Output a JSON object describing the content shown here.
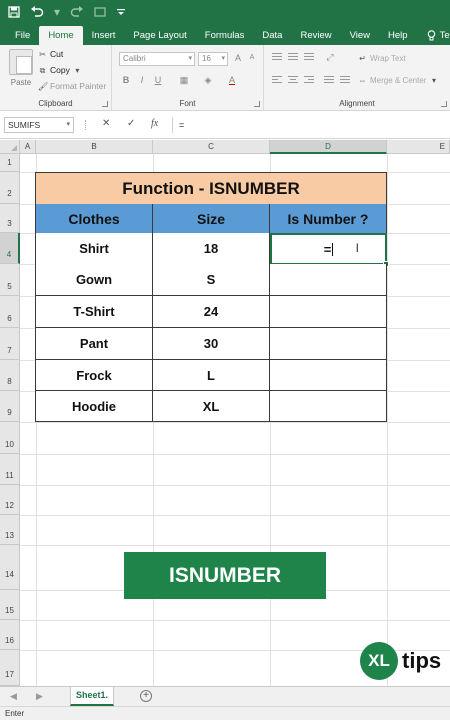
{
  "qat": {
    "save_icon": "save-icon",
    "undo_icon": "undo-icon",
    "redo_icon": "redo-icon",
    "touch_icon": "touch-mode-icon",
    "customize_icon": "customize-qat-icon"
  },
  "tabs": [
    {
      "label": "File",
      "active": false
    },
    {
      "label": "Home",
      "active": true
    },
    {
      "label": "Insert",
      "active": false
    },
    {
      "label": "Page Layout",
      "active": false
    },
    {
      "label": "Formulas",
      "active": false
    },
    {
      "label": "Data",
      "active": false
    },
    {
      "label": "Review",
      "active": false
    },
    {
      "label": "View",
      "active": false
    },
    {
      "label": "Help",
      "active": false
    }
  ],
  "tell_me": "Tell me w",
  "ribbon": {
    "clipboard": {
      "paste": "Paste",
      "cut": "Cut",
      "copy": "Copy",
      "format_painter": "Format Painter",
      "label": "Clipboard"
    },
    "font": {
      "name": "Calibri",
      "size": "16",
      "label": "Font",
      "bold": "B",
      "italic": "I",
      "underline": "U",
      "font_color": "A"
    },
    "alignment": {
      "wrap_text": "Wrap Text",
      "merge_center": "Merge & Center",
      "label": "Alignment"
    }
  },
  "formula_bar": {
    "name_box": "SUMIFS",
    "cancel": "✕",
    "enter": "✓",
    "fx": "fx",
    "content": "="
  },
  "columns": [
    "A",
    "B",
    "C",
    "D",
    "E"
  ],
  "rows": [
    "1",
    "2",
    "3",
    "4",
    "5",
    "6",
    "7",
    "8",
    "9",
    "10",
    "11",
    "12",
    "13",
    "14",
    "15",
    "16",
    "17"
  ],
  "table": {
    "title": "Function - ISNUMBER",
    "headers": [
      "Clothes",
      "Size",
      "Is Number ?"
    ],
    "rows": [
      [
        "Shirt",
        "18"
      ],
      [
        "Gown",
        "S"
      ],
      [
        "T-Shirt",
        "24"
      ],
      [
        "Pant",
        "30"
      ],
      [
        "Frock",
        "L"
      ],
      [
        "Hoodie",
        "XL"
      ]
    ],
    "active_cell_value": "="
  },
  "banner": "ISNUMBER",
  "logo": {
    "circle": "XL",
    "text": "tips"
  },
  "sheet_tab": "Sheet1.",
  "status": "Enter",
  "colors": {
    "excel_green": "#217346",
    "title_fill": "#f8cba4",
    "header_fill": "#5b9bd5",
    "banner_fill": "#1e8449"
  }
}
